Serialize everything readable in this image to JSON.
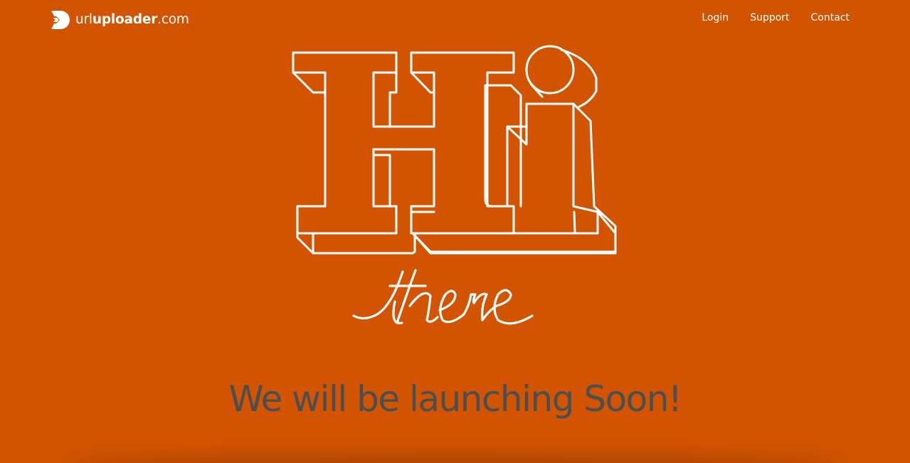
{
  "header": {
    "brand": {
      "prefix": "url",
      "name": "uploader",
      "suffix": ".com",
      "logo_icon": "arrow-d-logo-icon"
    },
    "nav": [
      {
        "label": "Login"
      },
      {
        "label": "Support"
      },
      {
        "label": "Contact"
      }
    ]
  },
  "hero": {
    "big_text": "Hi",
    "script_text": "there"
  },
  "main": {
    "headline": "We will be launching Soon!"
  },
  "colors": {
    "background": "#d35400",
    "foreground": "#ffffff",
    "headline": "#4b4f50"
  }
}
